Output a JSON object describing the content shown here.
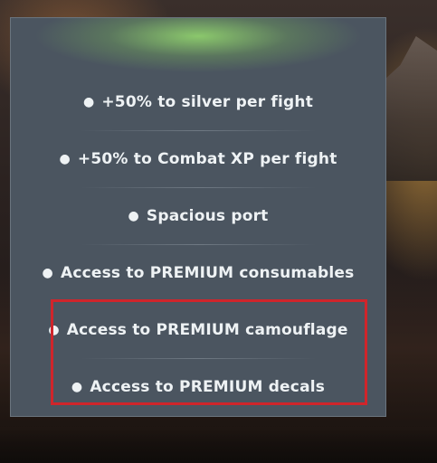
{
  "tooltip": {
    "items": [
      {
        "bullet": "●",
        "label": "+50% to silver per fight"
      },
      {
        "bullet": "●",
        "label": "+50% to Combat XP per fight"
      },
      {
        "bullet": "●",
        "label": "Spacious port"
      },
      {
        "bullet": "●",
        "label": "Access to PREMIUM consumables"
      },
      {
        "bullet": "●",
        "label": "Access to PREMIUM camouflage"
      },
      {
        "bullet": "●",
        "label": "Access to PREMIUM decals"
      }
    ]
  },
  "colors": {
    "panel_bg": "#4b5560",
    "highlight_border": "#d0252b",
    "glow": "#96dc6e",
    "text": "#eef2f4"
  }
}
